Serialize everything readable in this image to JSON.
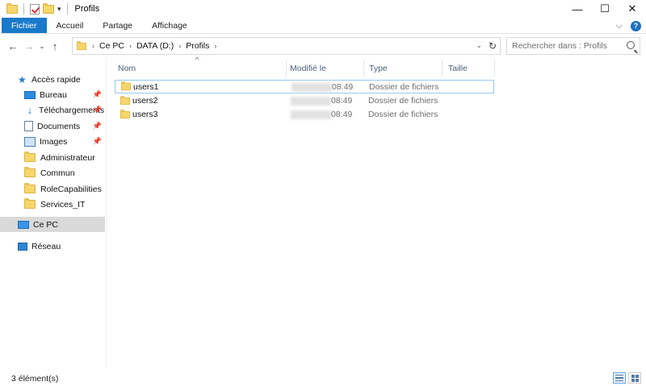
{
  "window": {
    "title": "Profils",
    "controls": {
      "minimize": "—",
      "maximize": "☐",
      "close": "✕"
    }
  },
  "ribbon": {
    "tabs": [
      {
        "label": "Fichier"
      },
      {
        "label": "Accueil"
      },
      {
        "label": "Partage"
      },
      {
        "label": "Affichage"
      }
    ],
    "help": "?"
  },
  "address": {
    "crumbs": [
      "Ce PC",
      "DATA (D:)",
      "Profils"
    ],
    "search_placeholder": "Rechercher dans : Profils"
  },
  "nav_pane": {
    "quick_access": "Accès rapide",
    "items": [
      {
        "label": "Bureau",
        "icon": "desktop-icon",
        "pinned": true
      },
      {
        "label": "Téléchargements",
        "icon": "download-icon",
        "pinned": true
      },
      {
        "label": "Documents",
        "icon": "document-icon",
        "pinned": true
      },
      {
        "label": "Images",
        "icon": "images-icon",
        "pinned": true
      },
      {
        "label": "Administrateur",
        "icon": "folder-icon",
        "pinned": false
      },
      {
        "label": "Commun",
        "icon": "folder-icon",
        "pinned": false
      },
      {
        "label": "RoleCapabilities",
        "icon": "folder-icon",
        "pinned": false
      },
      {
        "label": "Services_IT",
        "icon": "folder-icon",
        "pinned": false
      }
    ],
    "this_pc": "Ce PC",
    "network": "Réseau"
  },
  "columns": {
    "name": "Nom",
    "modified": "Modifié le",
    "type": "Type",
    "size": "Taille"
  },
  "files": [
    {
      "name": "users1",
      "modified": "08:49",
      "type": "Dossier de fichiers"
    },
    {
      "name": "users2",
      "modified": "08:49",
      "type": "Dossier de fichiers"
    },
    {
      "name": "users3",
      "modified": "08:49",
      "type": "Dossier de fichiers"
    }
  ],
  "status": {
    "count": "3 élément(s)"
  },
  "colors": {
    "file_tab": "#1979ca",
    "folder": "#f6d66a",
    "selection": "#d9d9d9",
    "focus_border": "#99c9ef"
  }
}
